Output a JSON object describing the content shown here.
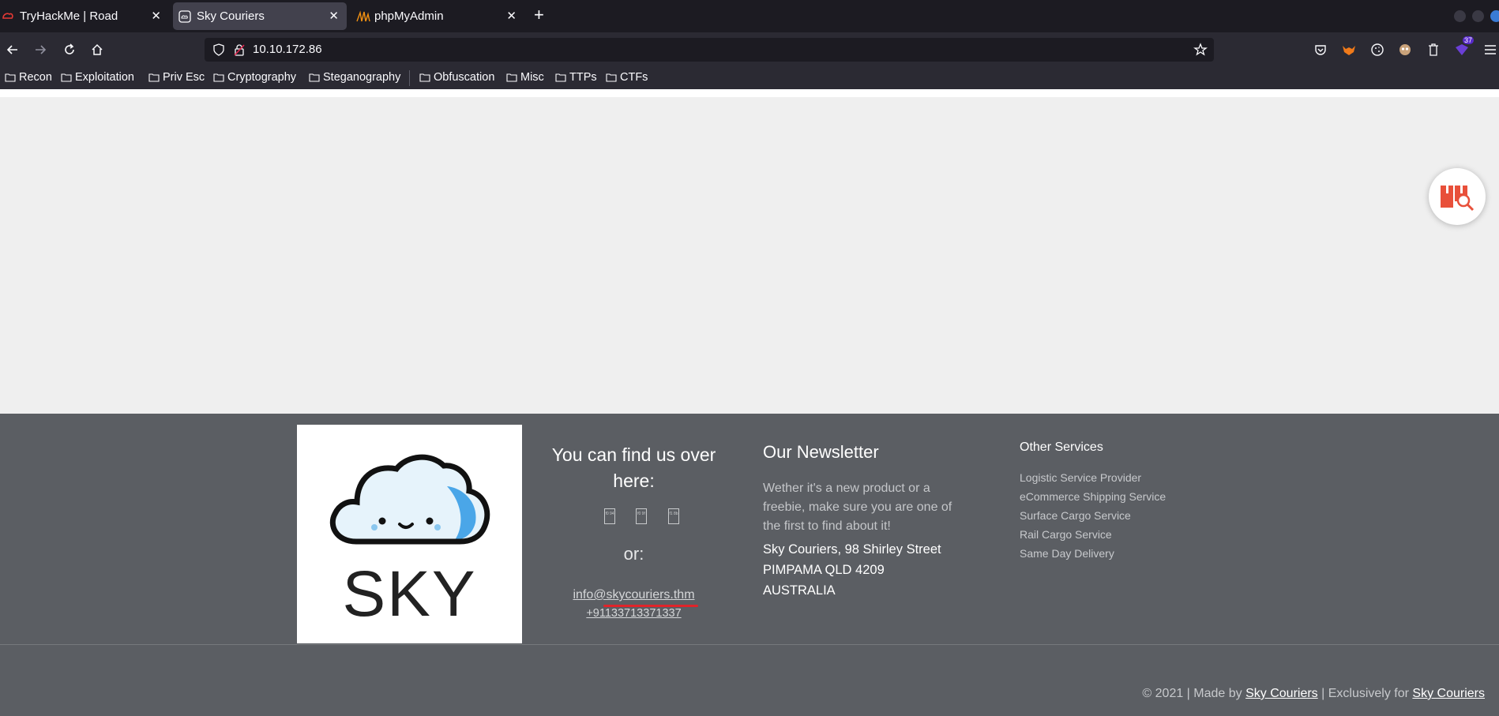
{
  "browser": {
    "tabs": [
      {
        "title": "TryHackMe | Road",
        "icon": "tryhackme-icon",
        "active": false
      },
      {
        "title": "Sky Couriers",
        "icon": "page-icon",
        "active": true
      },
      {
        "title": "phpMyAdmin",
        "icon": "phpmyadmin-icon",
        "active": false
      }
    ],
    "url": "10.10.172.86",
    "extension_badge": "37",
    "bookmarks": [
      "Recon",
      "Exploitation",
      "Priv Esc",
      "Cryptography",
      "Steganography",
      "Obfuscation",
      "Misc",
      "TTPs",
      "CTFs"
    ]
  },
  "footer": {
    "logo_text": "SKY",
    "find_us_title": "You can find us over here:",
    "social_icons": [
      "f0 94",
      "f0 9f",
      "f1 8b"
    ],
    "or_label": "or:",
    "email": "info@skycouriers.thm",
    "phone": "+91133713371337",
    "newsletter": {
      "title": "Our Newsletter",
      "description": "Wether it's a new product or a freebie, make sure you are one of the first to find about it!",
      "address_line1": "Sky Couriers, 98 Shirley Street",
      "address_line2": "PIMPAMA QLD 4209",
      "address_line3": "AUSTRALIA"
    },
    "other_services": {
      "title": "Other Services",
      "items": [
        "Logistic Service Provider",
        "eCommerce Shipping Service",
        "Surface Cargo Service",
        "Rail Cargo Service",
        "Same Day Delivery"
      ]
    },
    "copyright": {
      "prefix": "© 2021 | Made by ",
      "made_by": "Sky Couriers",
      "middle": " | Exclusively for ",
      "exclusive_for": "Sky Couriers"
    }
  },
  "colors": {
    "footer_bg": "#5b5e63",
    "page_bg": "#efefef",
    "accent_red": "#e0242a"
  }
}
